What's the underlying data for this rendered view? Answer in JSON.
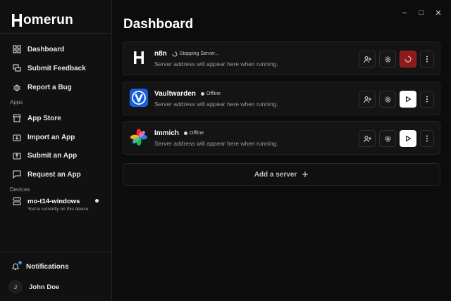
{
  "app": {
    "brand_tail": "omerun",
    "page_title": "Dashboard"
  },
  "sidebar": {
    "nav": [
      {
        "label": "Dashboard",
        "icon": "dashboard-icon"
      },
      {
        "label": "Submit Feedback",
        "icon": "feedback-icon"
      },
      {
        "label": "Report a Bug",
        "icon": "bug-icon"
      }
    ],
    "apps_section": "Apps",
    "apps": [
      {
        "label": "App Store",
        "icon": "store-icon"
      },
      {
        "label": "Import an App",
        "icon": "import-icon"
      },
      {
        "label": "Submit an App",
        "icon": "submit-icon"
      },
      {
        "label": "Request an App",
        "icon": "request-icon"
      }
    ],
    "devices_section": "Devices",
    "device": {
      "name": "mo-t14-windows",
      "subtitle": "You're currently on this device."
    },
    "notifications_label": "Notifications",
    "user": {
      "initial": "J",
      "name": "John Doe"
    }
  },
  "servers": [
    {
      "name": "n8n",
      "status": "Stopping Server...",
      "address": "Server address will appear here when running.",
      "state": "stopping"
    },
    {
      "name": "Vaultwarden",
      "status": "Offline",
      "address": "Server address will appear here when running.",
      "state": "offline"
    },
    {
      "name": "Immich",
      "status": "Offline",
      "address": "Server address will appear here when running.",
      "state": "offline"
    }
  ],
  "add_server_label": "Add a server",
  "colors": {
    "accent_stop": "#8a1c1c",
    "notification_badge": "#4a7dff",
    "vaultwarden_blue": "#175ddc"
  }
}
